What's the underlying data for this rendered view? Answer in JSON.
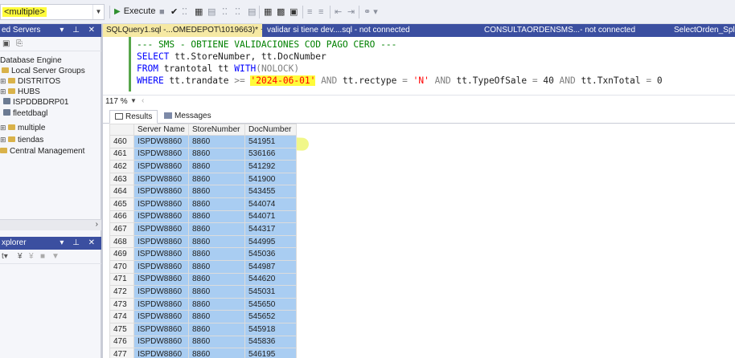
{
  "toolbar": {
    "database": "<multiple>",
    "execute_label": "Execute",
    "icons": [
      "stop-icon",
      "check-icon",
      "parse-icon",
      "display-plan-icon",
      "query-options-icon",
      "results-grid-icon",
      "results-text-icon",
      "comment-icon",
      "uncomment-icon",
      "indent-icon",
      "outdent-icon",
      "specify-values-icon"
    ]
  },
  "registered_servers": {
    "title": "ed Servers",
    "controls": "▾ ⊥ ✕",
    "tree": [
      {
        "label": "Database Engine",
        "type": "root"
      },
      {
        "label": "Local Server Groups",
        "type": "group"
      },
      {
        "label": "DISTRITOS",
        "type": "folder",
        "expandable": true
      },
      {
        "label": "HUBS",
        "type": "folder",
        "expandable": true
      },
      {
        "label": "ISPDDBDRP01",
        "type": "server"
      },
      {
        "label": "fleetdbagl",
        "type": "server"
      },
      {
        "label": "multiple",
        "type": "folder",
        "expandable": true
      },
      {
        "label": "tiendas",
        "type": "folder",
        "expandable": true
      },
      {
        "label": "Central Management",
        "type": "folder"
      }
    ]
  },
  "object_explorer": {
    "title": "xplorer",
    "controls": "▾ ⊥ ✕"
  },
  "tabs": [
    {
      "label": "SQLQuery1.sql -...OMEDEPOT\\1019663)*",
      "active": true,
      "pin": "⊣",
      "close": "✕"
    },
    {
      "label": "validar si tiene dev....sql - not connected",
      "active": false
    },
    {
      "label": "CONSULTAORDENSMS...- not connected",
      "active": false
    },
    {
      "label": "SelectOrden_Spl",
      "active": false
    }
  ],
  "editor": {
    "line1": "--- SMS - OBTIENE VALIDACIONES COD PAGO CERO ---",
    "line2_kw": "SELECT",
    "line2_rest": " tt.StoreNumber, tt.DocNumber",
    "line3_kw": "FROM",
    "line3_rest": " trantotal tt ",
    "line3_kw2": "WITH",
    "line3_paren": "(NOLOCK)",
    "line4_kw": "WHERE",
    "line4_a": " tt.trandate ",
    "line4_op": ">=",
    "line4_str": "'2024-06-01'",
    "line4_and1": "AND",
    "line4_b": " tt.rectype ",
    "line4_eq1": "=",
    "line4_str2": "'N'",
    "line4_and2": "AND",
    "line4_c": " tt.TypeOfSale ",
    "line4_eq2": "=",
    "line4_n1": " 40 ",
    "line4_and3": "AND",
    "line4_d": " tt.TxnTotal ",
    "line4_eq3": "=",
    "line4_n2": " 0"
  },
  "zoom": "117 %",
  "results_tabs": {
    "results": "Results",
    "messages": "Messages"
  },
  "grid": {
    "columns": [
      "",
      "Server Name",
      "StoreNumber",
      "DocNumber"
    ],
    "rows": [
      {
        "n": "460",
        "server": "ISPDW8860",
        "store": "8860",
        "doc": "541951"
      },
      {
        "n": "461",
        "server": "ISPDW8860",
        "store": "8860",
        "doc": "536166"
      },
      {
        "n": "462",
        "server": "ISPDW8860",
        "store": "8860",
        "doc": "541292"
      },
      {
        "n": "463",
        "server": "ISPDW8860",
        "store": "8860",
        "doc": "541900"
      },
      {
        "n": "464",
        "server": "ISPDW8860",
        "store": "8860",
        "doc": "543455"
      },
      {
        "n": "465",
        "server": "ISPDW8860",
        "store": "8860",
        "doc": "544074"
      },
      {
        "n": "466",
        "server": "ISPDW8860",
        "store": "8860",
        "doc": "544071"
      },
      {
        "n": "467",
        "server": "ISPDW8860",
        "store": "8860",
        "doc": "544317"
      },
      {
        "n": "468",
        "server": "ISPDW8860",
        "store": "8860",
        "doc": "544995"
      },
      {
        "n": "469",
        "server": "ISPDW8860",
        "store": "8860",
        "doc": "545036"
      },
      {
        "n": "470",
        "server": "ISPDW8860",
        "store": "8860",
        "doc": "544987"
      },
      {
        "n": "471",
        "server": "ISPDW8860",
        "store": "8860",
        "doc": "544620"
      },
      {
        "n": "472",
        "server": "ISPDW8860",
        "store": "8860",
        "doc": "545031"
      },
      {
        "n": "473",
        "server": "ISPDW8860",
        "store": "8860",
        "doc": "545650"
      },
      {
        "n": "474",
        "server": "ISPDW8860",
        "store": "8860",
        "doc": "545652"
      },
      {
        "n": "475",
        "server": "ISPDW8860",
        "store": "8860",
        "doc": "545918"
      },
      {
        "n": "476",
        "server": "ISPDW8860",
        "store": "8860",
        "doc": "545836"
      },
      {
        "n": "477",
        "server": "ISPDW8860",
        "store": "8860",
        "doc": "546195"
      }
    ]
  }
}
